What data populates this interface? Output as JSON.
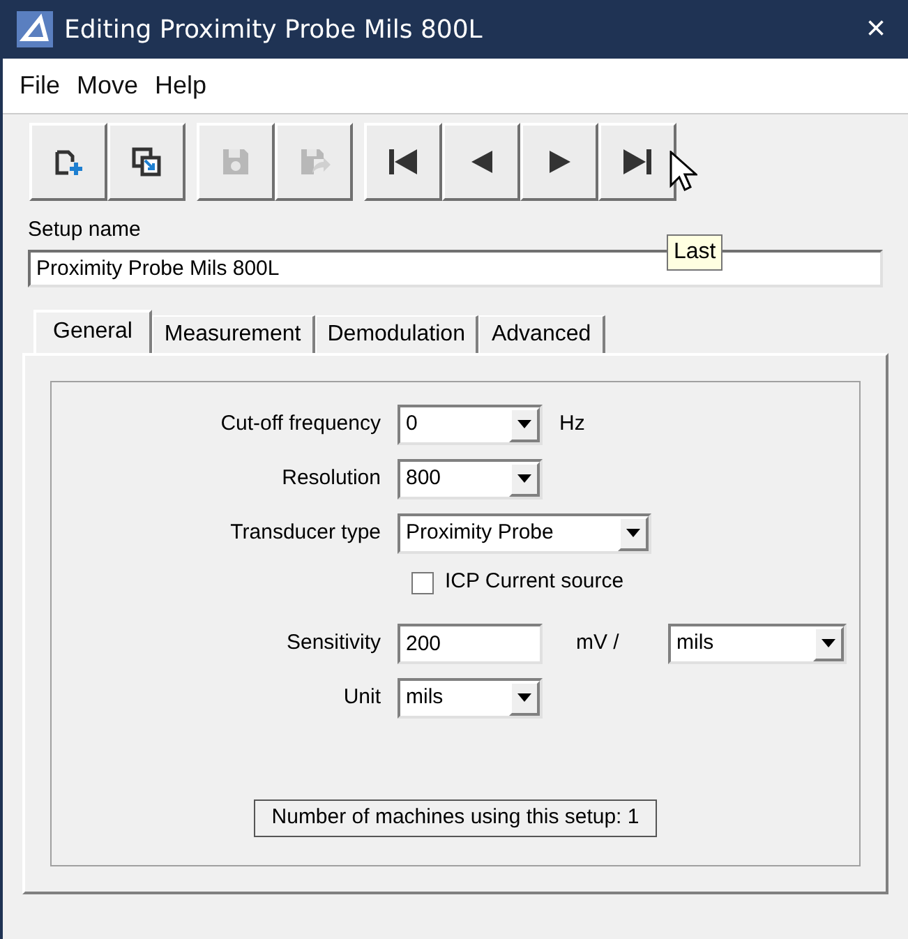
{
  "window": {
    "title": "Editing Proximity Probe Mils 800L",
    "close": "×"
  },
  "menu": [
    {
      "label": "File"
    },
    {
      "label": "Move"
    },
    {
      "label": "Help"
    }
  ],
  "toolbar": [
    [
      {
        "kind": "new",
        "disabled": false
      },
      {
        "kind": "copy",
        "disabled": false
      }
    ],
    [
      {
        "kind": "save",
        "disabled": true
      },
      {
        "kind": "save-as",
        "disabled": true
      }
    ],
    [
      {
        "kind": "first",
        "disabled": false
      },
      {
        "kind": "prev",
        "disabled": false
      },
      {
        "kind": "next",
        "disabled": false
      },
      {
        "kind": "last",
        "disabled": false
      }
    ]
  ],
  "tooltip": "Last",
  "setup_name": {
    "label": "Setup name",
    "value": "Proximity Probe Mils 800L"
  },
  "tabs": [
    {
      "label": "General",
      "selected": true
    },
    {
      "label": "Measurement",
      "selected": false
    },
    {
      "label": "Demodulation",
      "selected": false
    },
    {
      "label": "Advanced",
      "selected": false
    }
  ],
  "general": [
    {
      "kind": "combo",
      "label": "Cut-off frequency",
      "value": "0",
      "suffix": "Hz"
    },
    {
      "kind": "combo",
      "label": "Resolution",
      "value": "800"
    },
    {
      "kind": "combo",
      "label": "Transducer type",
      "value": "Proximity Probe"
    },
    {
      "kind": "checkbox",
      "label": "ICP Current source",
      "checked": false
    },
    {
      "kind": "text",
      "label": "Sensitivity",
      "value": "200",
      "suffix": "mV /",
      "unit": "mils"
    },
    {
      "kind": "combo",
      "label": "Unit",
      "value": "mils"
    }
  ],
  "footer": "Number of machines using this setup: 1"
}
